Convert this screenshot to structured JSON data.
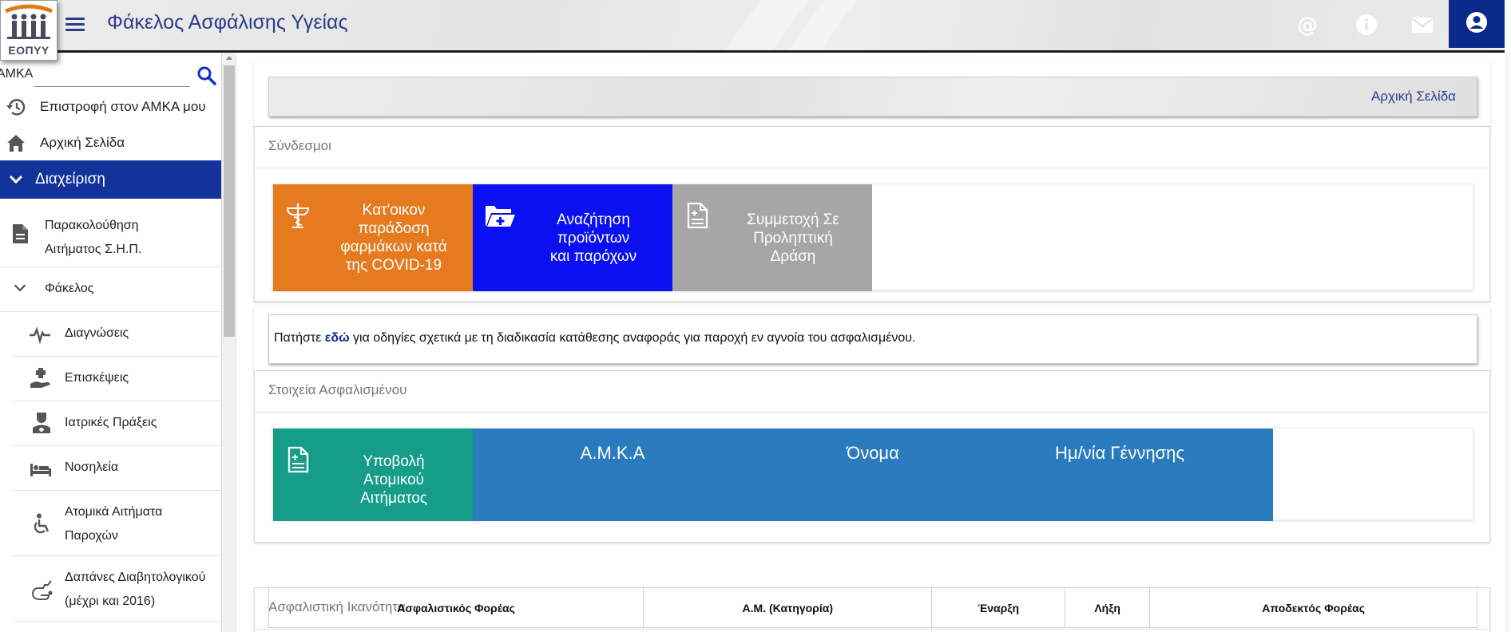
{
  "header": {
    "logo_text": "ΕΟΠΥΥ",
    "title": "Φάκελος Ασφάλισης Υγείας",
    "icons": [
      "at-icon",
      "info-icon",
      "mail-icon",
      "account-icon"
    ]
  },
  "sidebar": {
    "search_label": "ΑΜΚΑ",
    "search_value": "",
    "items": [
      {
        "label": "Επιστροφή στον ΑΜΚΑ μου",
        "icon": "history-icon"
      },
      {
        "label": "Αρχική Σελίδα",
        "icon": "home-icon"
      },
      {
        "label": "Διαχείριση",
        "icon": "chevron-down-icon",
        "active": true
      },
      {
        "label_line1": "Παρακολούθηση",
        "label_line2": "Αιτήματος Σ.Η.Π.",
        "icon": "document-icon"
      },
      {
        "label": "Φάκελος",
        "icon": "chevron-down-icon"
      },
      {
        "label": "Διαγνώσεις",
        "icon": "pulse-icon"
      },
      {
        "label": "Επισκέψεις",
        "icon": "care-hand-icon"
      },
      {
        "label": "Ιατρικές Πράξεις",
        "icon": "doctor-icon"
      },
      {
        "label": "Νοσηλεία",
        "icon": "bed-icon"
      },
      {
        "label_line1": "Ατομικά Αιτήματα",
        "label_line2": "Παροχών",
        "icon": "wheelchair-icon"
      },
      {
        "label_line1": "Δαπάνες Διαβητολογικού",
        "label_line2": "(μέχρι και 2016)",
        "icon": "diabetes-icon"
      }
    ]
  },
  "breadcrumb": {
    "home_label": "Αρχική Σελίδα"
  },
  "links_panel": {
    "title": "Σύνδεσμοι",
    "tiles": [
      {
        "label_lines": [
          "Κατ'οικον",
          "παράδοση",
          "φαρμάκων κατά",
          "της COVID-19"
        ],
        "color": "#e57a1f",
        "icon": "pharmacy-icon"
      },
      {
        "label_lines": [
          "Αναζήτηση",
          "προϊόντων",
          "και παρόχων"
        ],
        "color": "#0a10ef",
        "icon": "folder-plus-icon"
      },
      {
        "label_lines": [
          "Συμμετοχή Σε",
          "Προληπτική",
          "Δράση"
        ],
        "color": "#a6a6a6",
        "icon": "document-plus-icon"
      }
    ]
  },
  "notice": {
    "prefix": "Πατήστε ",
    "link_text": "εδώ",
    "suffix": " για οδηγίες σχετικά με τη διαδικασία κατάθεσης αναφοράς για παροχή εν αγνοία του ασφαλισμένου."
  },
  "insured_panel": {
    "title": "Στοιχεία Ασφαλισμένου",
    "submit_tile": {
      "label_lines": [
        "Υποβολή",
        "Ατομικού",
        "Αιτήματος"
      ],
      "color": "#159d8a",
      "icon": "document-plus-icon"
    },
    "columns": [
      "Α.Μ.Κ.Α",
      "Όνομα",
      "Ημ/νία Γέννησης"
    ],
    "band_color": "#2a7bbd"
  },
  "insurance_panel": {
    "title": "Ασφαλιστική Ικανότητα",
    "headers": [
      "Ασφαλιστικός Φορέας",
      "Α.Μ. (Κατηγορία)",
      "Έναρξη",
      "Λήξη",
      "Αποδεκτός Φορέας"
    ]
  }
}
